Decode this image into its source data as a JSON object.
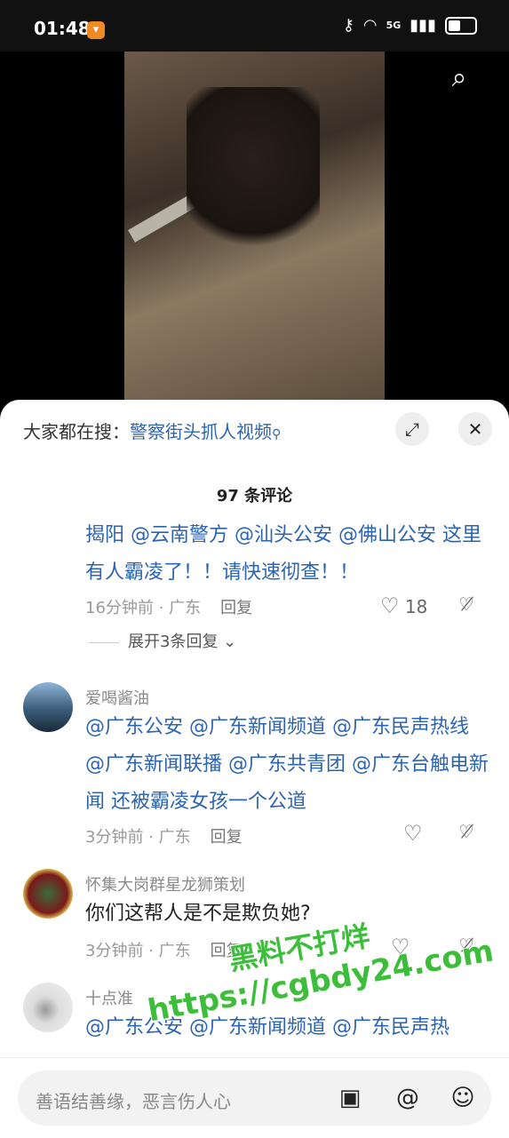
{
  "status_bar": {
    "time": "01:48",
    "network": "5G"
  },
  "trending": {
    "prefix": "大家都在搜：",
    "keyword": "警察街头抓人视频"
  },
  "comments_header": {
    "count_label": "97 条评论"
  },
  "comments": [
    {
      "text_parts": [
        "揭阳 @云南警方 @汕头公安 @佛山公安 这里有人霸凌了！！请快速彻查！！"
      ],
      "time": "16分钟前 · 广东",
      "reply": "回复",
      "likes": "18",
      "expand": "展开3条回复"
    },
    {
      "username": "爱喝酱油",
      "text_parts": [
        "@广东公安 @广东新闻频道 @广东民声热线 @广东新闻联播 @广东共青团 @广东台触电新闻 还被霸凌女孩一个公道"
      ],
      "time": "3分钟前 · 广东",
      "reply": "回复"
    },
    {
      "username": "怀集大岗群星龙狮策划",
      "text_parts": [
        "你们这帮人是不是欺负她?"
      ],
      "time": "3分钟前 · 广东",
      "reply": "回复"
    },
    {
      "username": "十点准",
      "text_parts": [
        "@广东公安 @广东新闻频道 @广东民声热"
      ]
    }
  ],
  "watermark": {
    "line1": "黑料不打烊",
    "line2": "https://cgbdy24.com"
  },
  "input": {
    "placeholder": "善语结善缘，恶言伤人心"
  },
  "icons": [
    "search-icon",
    "expand-icon",
    "close-icon",
    "heart-icon",
    "dislike-icon",
    "image-icon",
    "at-icon",
    "emoji-icon"
  ]
}
